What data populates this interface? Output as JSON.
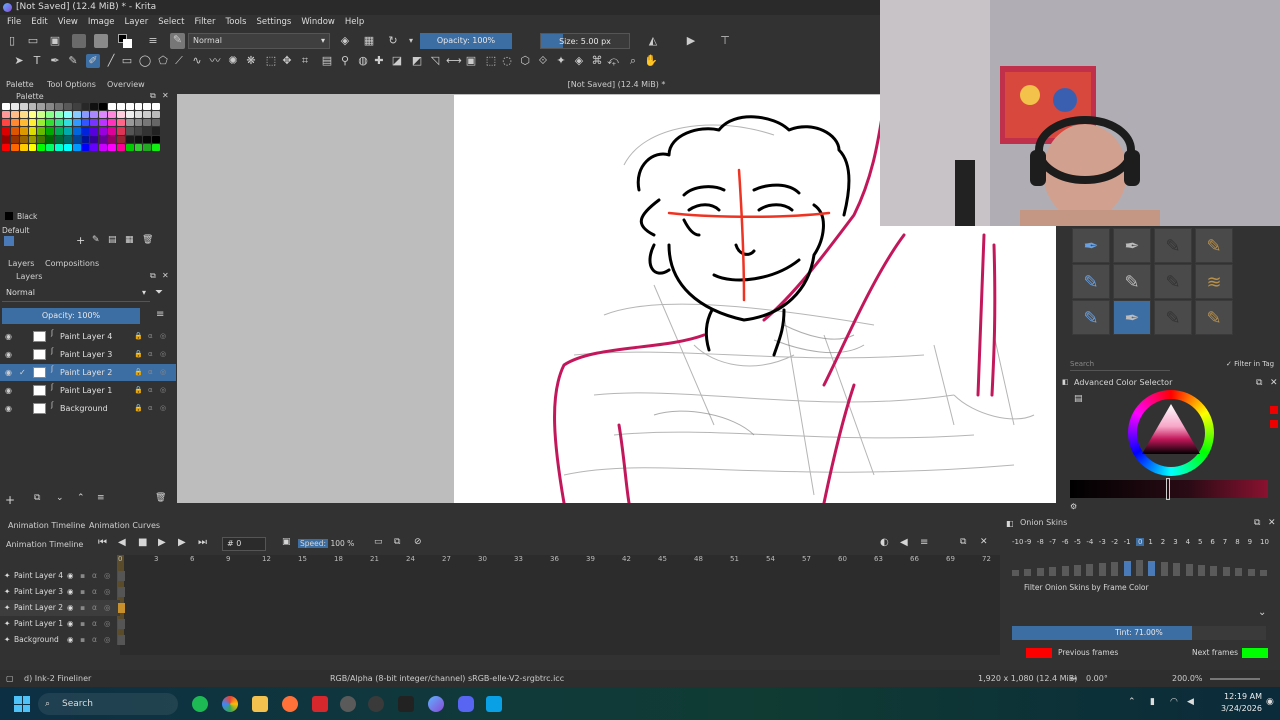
{
  "window": {
    "title": "[Not Saved]  (12.4 MiB) * - Krita"
  },
  "menu": [
    "File",
    "Edit",
    "View",
    "Image",
    "Layer",
    "Select",
    "Filter",
    "Tools",
    "Settings",
    "Window",
    "Help"
  ],
  "toolbar": {
    "blend_mode": "Normal",
    "opacity": "Opacity: 100%",
    "size": "Size: 5.00 px"
  },
  "left_tabs": [
    "Palette",
    "Tool Options",
    "Overview"
  ],
  "palette": {
    "title": "Palette",
    "current_color_name": "Black",
    "palette_name": "Default",
    "swatches": [
      "#ffffff",
      "#e8e8e8",
      "#d0d0d0",
      "#b8b8b8",
      "#a0a0a0",
      "#888888",
      "#707070",
      "#585858",
      "#404040",
      "#282828",
      "#101010",
      "#000000",
      "#ffffff",
      "#ffffff",
      "#ffffff",
      "#ffffff",
      "#ffffff",
      "#ffffff",
      "#ff9999",
      "#ffbb88",
      "#ffdd88",
      "#ffff88",
      "#ccff88",
      "#88ff88",
      "#88ffbb",
      "#88ffff",
      "#88ccff",
      "#8899ff",
      "#aa88ff",
      "#dd88ff",
      "#ff88dd",
      "#ffccdd",
      "#eeeeee",
      "#dddddd",
      "#cccccc",
      "#bbbbbb",
      "#ff4444",
      "#ff8833",
      "#ffbb33",
      "#ffee33",
      "#99ee33",
      "#33dd33",
      "#33dd88",
      "#33dddd",
      "#3399ff",
      "#3355ff",
      "#7733ff",
      "#bb33ff",
      "#ff33bb",
      "#ff6688",
      "#999999",
      "#888888",
      "#777777",
      "#666666",
      "#dd0000",
      "#dd5500",
      "#dd9900",
      "#dddd00",
      "#66bb00",
      "#00aa00",
      "#00aa55",
      "#00aaaa",
      "#0066dd",
      "#0022dd",
      "#5500dd",
      "#9900dd",
      "#dd0099",
      "#dd3355",
      "#555555",
      "#444444",
      "#333333",
      "#222222",
      "#990000",
      "#993300",
      "#996600",
      "#999900",
      "#447700",
      "#006600",
      "#006633",
      "#006666",
      "#004499",
      "#001199",
      "#330099",
      "#660099",
      "#990066",
      "#992233",
      "#1a1a1a",
      "#111111",
      "#080808",
      "#000000",
      "#ff0000",
      "#ff6600",
      "#ffcc00",
      "#ffff00",
      "#00ff00",
      "#00ff66",
      "#00ffcc",
      "#00ffff",
      "#0099ff",
      "#0000ff",
      "#6600ff",
      "#cc00ff",
      "#ff00ff",
      "#ff0099",
      "#00cc00",
      "#33cc33",
      "#22aa22",
      "#11ee11"
    ]
  },
  "layers": {
    "tabs": [
      "Layers",
      "Compositions"
    ],
    "blend": "Normal",
    "opacity": "Opacity:  100%",
    "items": [
      {
        "name": "Paint Layer 4",
        "selected": false
      },
      {
        "name": "Paint Layer 3",
        "selected": false
      },
      {
        "name": "Paint Layer 2",
        "selected": true
      },
      {
        "name": "Paint Layer 1",
        "selected": false
      },
      {
        "name": "Background",
        "selected": false
      }
    ]
  },
  "canvas": {
    "tab_title": "[Not Saved]  (12.4 MiB) *"
  },
  "brushes": {
    "search_placeholder": "Search",
    "filter_label": "Filter in Tag"
  },
  "color_selector": {
    "title": "Advanced Color Selector"
  },
  "timeline": {
    "tabs": [
      "Animation Timeline",
      "Animation Curves"
    ],
    "title": "Animation Timeline",
    "frame": "0",
    "speed_label": "Speed:",
    "speed": "100 %",
    "frame_numbers": [
      "0",
      "3",
      "6",
      "9",
      "12",
      "15",
      "18",
      "21",
      "24",
      "27",
      "30",
      "33",
      "36",
      "39",
      "42",
      "45",
      "48",
      "51",
      "54",
      "57",
      "60",
      "63",
      "66",
      "69",
      "72"
    ],
    "layers": [
      {
        "name": "Paint Layer 4",
        "selected": false
      },
      {
        "name": "Paint Layer 3",
        "selected": false
      },
      {
        "name": "Paint Layer 2",
        "selected": true
      },
      {
        "name": "Paint Layer 1",
        "selected": false
      },
      {
        "name": "Background",
        "selected": false
      }
    ]
  },
  "onion": {
    "title": "Onion Skins",
    "numbers": [
      "-10",
      "-9",
      "-8",
      "-7",
      "-6",
      "-5",
      "-4",
      "-3",
      "-2",
      "-1",
      "0",
      "1",
      "2",
      "3",
      "4",
      "5",
      "6",
      "7",
      "8",
      "9",
      "10"
    ],
    "filter_label": "Filter Onion Skins by Frame Color",
    "tint": "Tint: 71.00%",
    "tint_level": 0.71,
    "previous_label": "Previous frames",
    "next_label": "Next frames",
    "previous_color": "#ff0000",
    "next_color": "#00ff00"
  },
  "status": {
    "brush": "d) Ink-2 Fineliner",
    "color_space": "RGB/Alpha (8-bit integer/channel)  sRGB-elle-V2-srgbtrc.icc",
    "dimensions": "1,920 x 1,080 (12.4 MiB)",
    "rotation": "0.00°",
    "zoom": "200.0%"
  },
  "taskbar": {
    "search": "Search",
    "time": "12:19 AM",
    "date": "3/24/2026"
  }
}
